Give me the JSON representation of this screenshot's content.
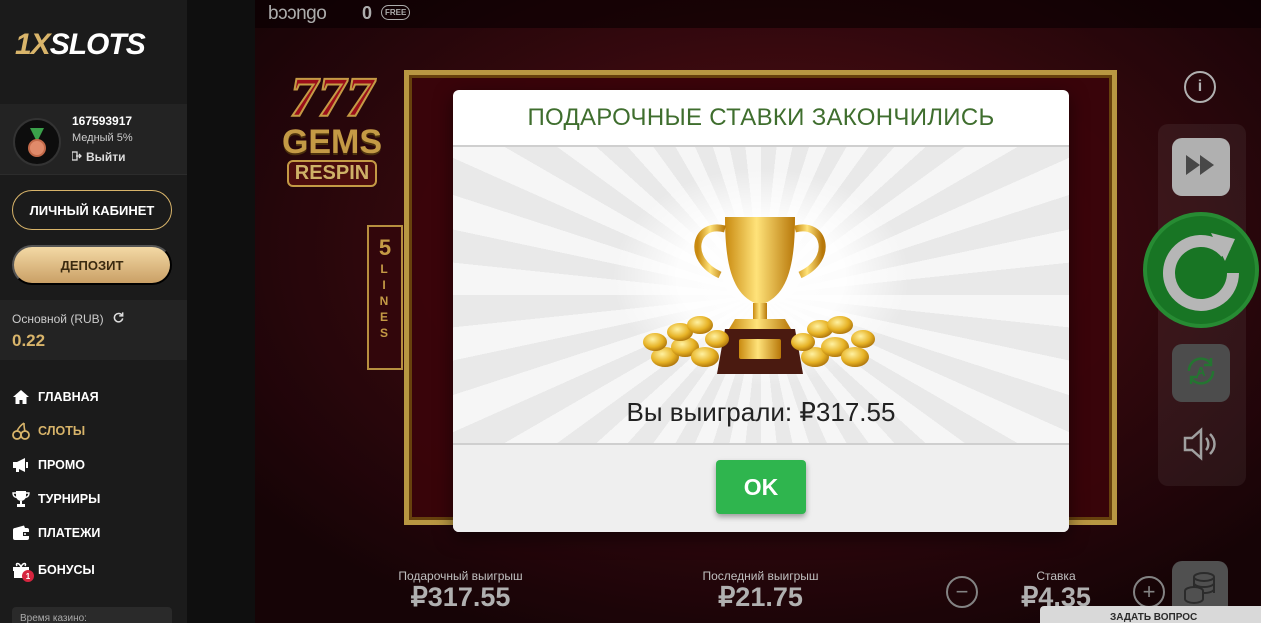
{
  "sidebar": {
    "logo": {
      "prefix": "1X",
      "suffix": "SLOTS"
    },
    "user": {
      "id": "167593917",
      "level": "Медный 5%",
      "logout_label": "Выйти"
    },
    "cabinet_label": "ЛИЧНЫЙ КАБИНЕТ",
    "deposit_label": "ДЕПОЗИТ",
    "balance": {
      "label": "Основной (RUB)",
      "value": "0.22"
    },
    "nav": [
      {
        "label": "ГЛАВНАЯ",
        "icon": "home-icon"
      },
      {
        "label": "СЛОТЫ",
        "icon": "cherries-icon",
        "active": true
      },
      {
        "label": "ПРОМО",
        "icon": "megaphone-icon"
      },
      {
        "label": "ТУРНИРЫ",
        "icon": "trophy-icon"
      },
      {
        "label": "ПЛАТЕЖИ",
        "icon": "wallet-icon"
      },
      {
        "label": "БОНУСЫ",
        "icon": "gift-icon",
        "badge": "1"
      }
    ],
    "casino_time_label": "Время казино:"
  },
  "game": {
    "provider": "bɔɔngo",
    "free_count": "0",
    "free_badge": "FREE",
    "title": {
      "top": "777",
      "middle": "GEMS",
      "bottom": "RESPIN"
    },
    "lines": {
      "number": "5",
      "word": "LINES"
    },
    "stats": {
      "gift_win": {
        "label": "Подарочный выигрыш",
        "value": "₽317.55"
      },
      "last_win": {
        "label": "Последний выигрыш",
        "value": "₽21.75"
      },
      "bet": {
        "label": "Ставка",
        "value": "₽4.35"
      }
    },
    "minus_label": "−",
    "plus_label": "+",
    "info_label": "i",
    "corner_popup_text": "ЗАДАТЬ ВОПРОС"
  },
  "modal": {
    "title": "ПОДАРОЧНЫЕ СТАВКИ ЗАКОНЧИЛИСЬ",
    "win_text": "Вы выиграли: ₽317.55",
    "ok_label": "OK"
  },
  "colors": {
    "accent_gold": "#d8b46a",
    "ok_green": "#2fb54e",
    "modal_title_green": "#3f6e2e",
    "spin_green": "#1d8a2b"
  }
}
